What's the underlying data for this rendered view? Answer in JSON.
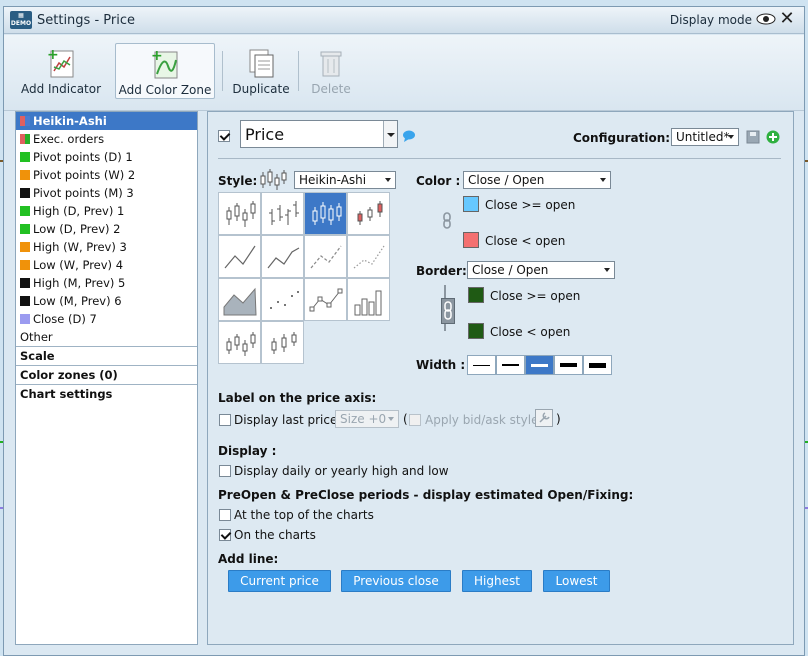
{
  "window": {
    "title": "Settings - Price",
    "display_mode": "Display mode"
  },
  "toolbar": {
    "add_indicator": "Add Indicator",
    "add_color_zone": "Add Color Zone",
    "duplicate": "Duplicate",
    "delete": "Delete"
  },
  "sidebar": {
    "items": [
      {
        "label": "Heikin-Ashi",
        "color": "#e06060",
        "color2": "#4a7bd0"
      },
      {
        "label": "Exec. orders",
        "color": "#e06060",
        "color2": "#28b028"
      },
      {
        "label": "Pivot points (D) 1",
        "color": "#22c022"
      },
      {
        "label": "Pivot points (W) 2",
        "color": "#f0920a"
      },
      {
        "label": "Pivot points (M) 3",
        "color": "#111111"
      },
      {
        "label": "High (D, Prev) 1",
        "color": "#22c022"
      },
      {
        "label": "Low (D, Prev) 2",
        "color": "#22c022"
      },
      {
        "label": "High (W, Prev) 3",
        "color": "#f0920a"
      },
      {
        "label": "Low (W, Prev) 4",
        "color": "#f0920a"
      },
      {
        "label": "High (M, Prev) 5",
        "color": "#111111"
      },
      {
        "label": "Low (M, Prev) 6",
        "color": "#111111"
      },
      {
        "label": "Close (D) 7",
        "color": "#9b9bf0"
      }
    ],
    "other": "Other",
    "sections": [
      "Scale",
      "Color zones (0)",
      "Chart settings"
    ]
  },
  "main": {
    "name_value": "Price",
    "configuration_label": "Configuration:",
    "configuration_value": "Untitled*",
    "style_label": "Style:",
    "style_value": "Heikin-Ashi",
    "color_label": "Color :",
    "color_value": "Close / Open",
    "color_up_label": "Close >= open",
    "color_down_label": "Close < open",
    "color_up": "#66c8ff",
    "color_down": "#f47070",
    "border_label": "Border:",
    "border_value": "Close / Open",
    "border_up_label": "Close >= open",
    "border_down_label": "Close < open",
    "border_up": "#1f5a14",
    "border_down": "#1f5a14",
    "width_label": "Width :",
    "label_axis_heading": "Label on the price axis:",
    "display_last_price": "Display last price",
    "size_value": "Size +0",
    "apply_bid_ask": "Apply bid/ask style",
    "paren_open": "(",
    "paren_close": ")",
    "display_heading": "Display :",
    "display_daily": "Display daily or yearly high and low",
    "preopen_heading": "PreOpen & PreClose periods - display estimated Open/Fixing:",
    "at_top": "At the top of the charts",
    "on_charts": "On the charts",
    "add_line_heading": "Add line:",
    "add_line_buttons": [
      "Current price",
      "Previous close",
      "Highest",
      "Lowest"
    ]
  }
}
